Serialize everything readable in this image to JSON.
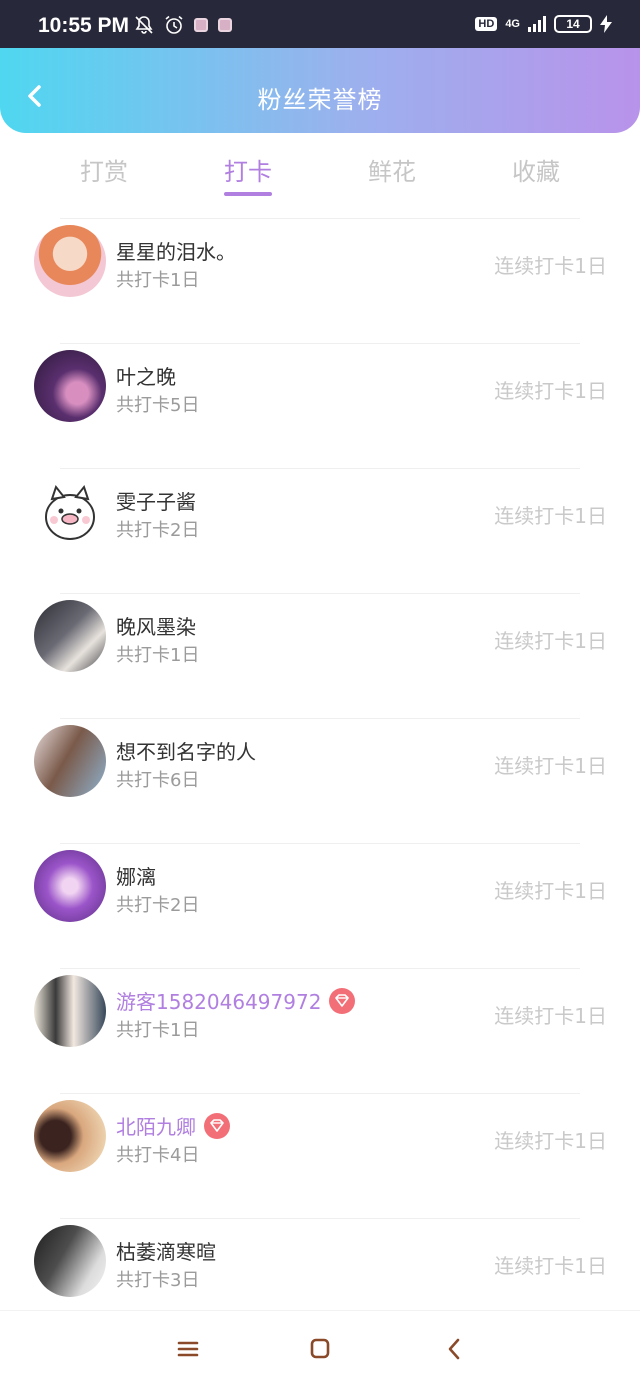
{
  "status_bar": {
    "time": "10:55 PM",
    "network_hd": "HD",
    "network_type": "4G",
    "battery": "14",
    "icons": [
      "bell-off-icon",
      "alarm-icon",
      "app-notification-icon",
      "app-notification-icon",
      "signal-icon",
      "charging-icon"
    ]
  },
  "header": {
    "title": "粉丝荣誉榜",
    "back_icon": "chevron-left-icon",
    "gradient": [
      "#4fd7f0",
      "#b893ea"
    ]
  },
  "tabs": [
    {
      "label": "打赏",
      "active": false
    },
    {
      "label": "打卡",
      "active": true
    },
    {
      "label": "鲜花",
      "active": false
    },
    {
      "label": "收藏",
      "active": false
    }
  ],
  "accent_color": "#b07fe0",
  "items": [
    {
      "name": "星星的泪水。",
      "total": "共打卡1日",
      "streak": "连续打卡1日",
      "vip": false
    },
    {
      "name": "叶之晚",
      "total": "共打卡5日",
      "streak": "连续打卡1日",
      "vip": false
    },
    {
      "name": "雯子子酱",
      "total": "共打卡2日",
      "streak": "连续打卡1日",
      "vip": false
    },
    {
      "name": "晚风墨染",
      "total": "共打卡1日",
      "streak": "连续打卡1日",
      "vip": false
    },
    {
      "name": "想不到名字的人",
      "total": "共打卡6日",
      "streak": "连续打卡1日",
      "vip": false
    },
    {
      "name": "娜漓",
      "total": "共打卡2日",
      "streak": "连续打卡1日",
      "vip": false
    },
    {
      "name": "游客1582046497972",
      "total": "共打卡1日",
      "streak": "连续打卡1日",
      "vip": true
    },
    {
      "name": "北陌九卿",
      "total": "共打卡4日",
      "streak": "连续打卡1日",
      "vip": true
    },
    {
      "name": "枯萎滴寒暄",
      "total": "共打卡3日",
      "streak": "连续打卡1日",
      "vip": false
    }
  ],
  "nav_bar": [
    "menu-icon",
    "home-square-icon",
    "back-chevron-icon"
  ]
}
